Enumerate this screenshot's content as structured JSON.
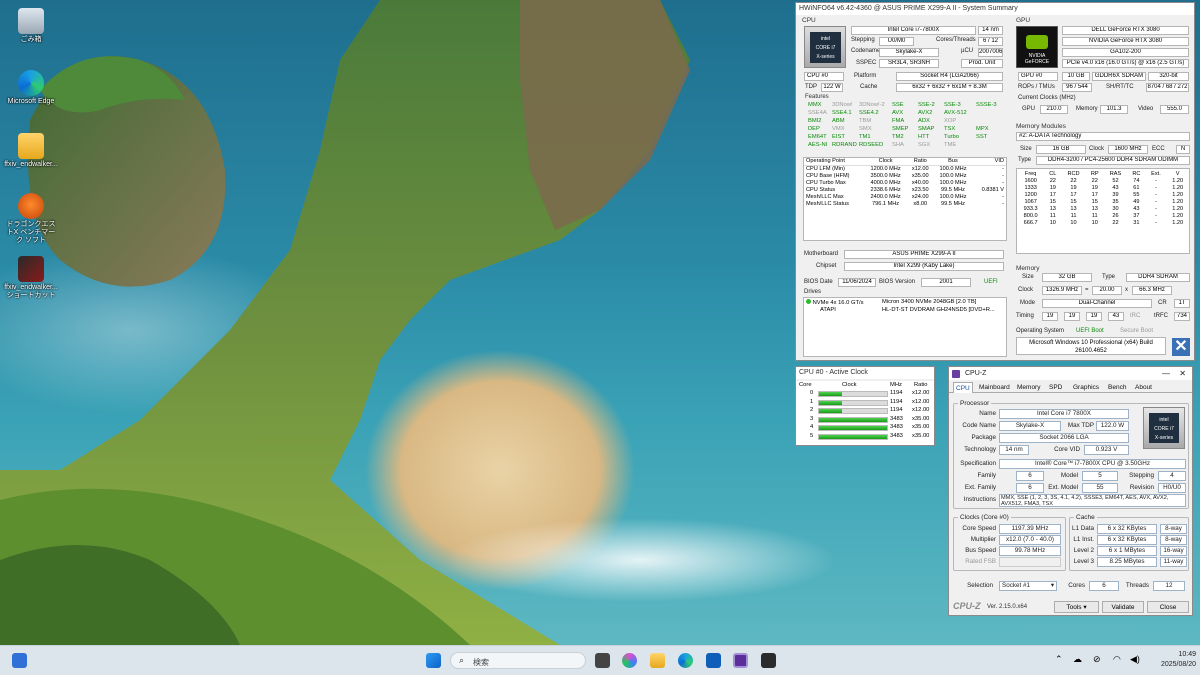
{
  "desktop": {
    "icons": [
      {
        "label": "ごみ箱",
        "icon": "recycle-bin-icon"
      },
      {
        "label": "Microsoft Edge",
        "icon": "edge-icon"
      },
      {
        "label": "ffxiv_endwalker...",
        "icon": "folder-icon"
      },
      {
        "label": "ドラゴンクエストX ベンチマーク ソフト",
        "icon": "dqx-benchmark-icon"
      },
      {
        "label": "ffxiv_endwalker... ショートカット",
        "icon": "ffxiv-shortcut-icon"
      }
    ]
  },
  "hwinfo": {
    "title": "HWiNFO64 v6.42-4360 @ ASUS PRIME X299-A II - System Summary",
    "cpu": {
      "section": "CPU",
      "name": "Intel Core i7-7800X",
      "node": "14 nm",
      "stepping_label": "Stepping",
      "stepping": "U0/M0",
      "ct_label": "Cores/Threads",
      "ct": "6 / 12",
      "codename_label": "Codename",
      "codename": "Skylake-X",
      "ucu_label": "µCU",
      "ucu": "2007006",
      "sspec_label": "SSPEC",
      "sspec": "SR3L4, SR3NH",
      "prod": "Prod. Unit",
      "sel": "CPU #0",
      "platform_label": "Platform",
      "platform": "Socket R4 (LGA2066)",
      "tdp_label": "TDP",
      "tdp": "122 W",
      "cache_label": "Cache",
      "cache": "6x32 + 6x32 + 6x1M + 8.3M",
      "features_label": "Features",
      "features": [
        [
          [
            "MMX",
            "g"
          ],
          [
            "3DNow!",
            "y"
          ],
          [
            "3DNow!-2",
            "y"
          ],
          [
            "SSE",
            "g"
          ],
          [
            "SSE-2",
            "g"
          ],
          [
            "SSE-3",
            "g"
          ],
          [
            "SSSE-3",
            "g"
          ]
        ],
        [
          [
            "SSE4A",
            "y"
          ],
          [
            "SSE4.1",
            "g"
          ],
          [
            "SSE4.2",
            "g"
          ],
          [
            "AVX",
            "g"
          ],
          [
            "AVX2",
            "g"
          ],
          [
            "AVX-512",
            "g"
          ],
          [
            "",
            ""
          ]
        ],
        [
          [
            "BMI2",
            "g"
          ],
          [
            "ABM",
            "g"
          ],
          [
            "TBM",
            "y"
          ],
          [
            "FMA",
            "g"
          ],
          [
            "ADX",
            "g"
          ],
          [
            "XOP",
            "y"
          ],
          [
            "",
            ""
          ]
        ],
        [
          [
            "DEP",
            "g"
          ],
          [
            "VMX",
            "y"
          ],
          [
            "SMX",
            "y"
          ],
          [
            "SMEP",
            "g"
          ],
          [
            "SMAP",
            "g"
          ],
          [
            "TSX",
            "g"
          ],
          [
            "MPX",
            "g"
          ]
        ],
        [
          [
            "EM64T",
            "g"
          ],
          [
            "EIST",
            "g"
          ],
          [
            "TM1",
            "g"
          ],
          [
            "TM2",
            "g"
          ],
          [
            "HTT",
            "g"
          ],
          [
            "Turbo",
            "g"
          ],
          [
            "SST",
            "g"
          ]
        ],
        [
          [
            "AES-NI",
            "g"
          ],
          [
            "RDRAND",
            "g"
          ],
          [
            "RDSEED",
            "g"
          ],
          [
            "SHA",
            "y"
          ],
          [
            "SGX",
            "y"
          ],
          [
            "TME",
            "y"
          ],
          [
            "",
            ""
          ]
        ]
      ],
      "op_headers": [
        "Operating Point",
        "Clock",
        "Ratio",
        "Bus",
        "VID"
      ],
      "op_rows": [
        [
          "CPU LFM (Min)",
          "1200.0 MHz",
          "x12.00",
          "100.0 MHz",
          "-"
        ],
        [
          "CPU Base (HFM)",
          "3500.0 MHz",
          "x35.00",
          "100.0 MHz",
          "-"
        ],
        [
          "CPU Turbo Max",
          "4000.0 MHz",
          "x40.00",
          "100.0 MHz",
          "-"
        ],
        [
          "CPU Status",
          "2338.6 MHz",
          "x23.50",
          "99.5 MHz",
          "0.8381 V"
        ],
        [
          "Mesh/LLC Max",
          "2400.0 MHz",
          "x24.00",
          "100.0 MHz",
          "-"
        ],
        [
          "Mesh/LLC Status",
          "796.1 MHz",
          "x8.00",
          "99.5 MHz",
          "-"
        ]
      ],
      "mb_label": "Motherboard",
      "mb": "ASUS PRIME X299-A II",
      "chipset_label": "Chipset",
      "chipset": "Intel X299 (Kaby Lake)",
      "bios_date_label": "BIOS Date",
      "bios_date": "11/06/2024",
      "bios_ver_label": "BIOS Version",
      "bios_ver": "2001",
      "uefi": "UEFI",
      "drives_label": "Drives",
      "drives": [
        [
          "NVMe 4x 16.0 GT/s",
          "Micron 3400 NVMe 2048GB [2.0 TB]"
        ],
        [
          "ATAPI",
          "HL-DT-ST DVDRAM GH24NSD5 [DVD+R..."
        ]
      ]
    },
    "gpu": {
      "section": "GPU",
      "name": "DELL GeForce RTX 3080",
      "full": "NVIDIA GeForce RTX 3080",
      "chip": "GA102-200",
      "pcie": "PCIe v4.0 x16 (16.0 GT/s) @ x16 (2.5 GT/s)",
      "sel": "GPU #0",
      "mem": "10 GB",
      "memtype": "GDDR6X SDRAM",
      "bus": "320-bit",
      "rops_label": "ROPs / TMUs",
      "rops": "96 / 544",
      "sh_label": "SH/RT/TC",
      "sh": "8704 / 68 / 272",
      "clocks_label": "Current Clocks (MHz)",
      "gpu_label": "GPU",
      "gpu_clk": "210.0",
      "mem_label": "Memory",
      "mem_clk": "101.3",
      "video_label": "Video",
      "video_clk": "555.0"
    },
    "modules": {
      "section": "Memory Modules",
      "sel": "#2: A-DATA Technology",
      "size_label": "Size",
      "size": "16 GB",
      "clock_label": "Clock",
      "clock": "1600 MHz",
      "ecc_label": "ECC",
      "ecc": "N",
      "type_label": "Type",
      "type": "DDR4-3200 / PC4-25600 DDR4 SDRAM UDIMM",
      "headers": [
        "Freq",
        "CL",
        "RCD",
        "RP",
        "RAS",
        "RC",
        "Ext.",
        "V"
      ],
      "rows": [
        [
          "1600",
          "22",
          "22",
          "22",
          "52",
          "74",
          "-",
          "1.20"
        ],
        [
          "1333",
          "19",
          "19",
          "19",
          "43",
          "61",
          "-",
          "1.20"
        ],
        [
          "1200",
          "17",
          "17",
          "17",
          "39",
          "55",
          "-",
          "1.20"
        ],
        [
          "1067",
          "15",
          "15",
          "15",
          "35",
          "49",
          "-",
          "1.20"
        ],
        [
          "933.3",
          "13",
          "13",
          "13",
          "30",
          "43",
          "-",
          "1.20"
        ],
        [
          "800.0",
          "11",
          "11",
          "11",
          "26",
          "37",
          "-",
          "1.20"
        ],
        [
          "666.7",
          "10",
          "10",
          "10",
          "22",
          "31",
          "-",
          "1.20"
        ]
      ]
    },
    "memory": {
      "section": "Memory",
      "size_label": "Size",
      "size": "32 GB",
      "type_label": "Type",
      "type": "DDR4 SDRAM",
      "clock_label": "Clock",
      "clock": "1326.9 MHz",
      "eq": "=",
      "mult": "20.00",
      "x": "x",
      "base": "66.3 MHz",
      "mode_label": "Mode",
      "mode": "Dual-Channel",
      "cr_label": "CR",
      "cr": "1T",
      "timing_label": "Timing",
      "t1": "19",
      "t2": "19",
      "t3": "19",
      "t4": "43",
      "trc": "tRC",
      "trfc_label": "tRFC",
      "trfc": "734"
    },
    "os": {
      "section": "Operating System",
      "uefi": "UEFI Boot",
      "secure": "Secure Boot",
      "name": "Microsoft Windows 10 Professional (x64) Build 26100.4652"
    }
  },
  "active_clock": {
    "title": "CPU #0 - Active Clock",
    "headers": [
      "Core",
      "Clock",
      "MHz",
      "Ratio"
    ],
    "rows": [
      {
        "core": "0",
        "fill": 0.34,
        "mhz": "1194",
        "ratio": "x12.00"
      },
      {
        "core": "1",
        "fill": 0.34,
        "mhz": "1194",
        "ratio": "x12.00"
      },
      {
        "core": "2",
        "fill": 0.34,
        "mhz": "1194",
        "ratio": "x12.00"
      },
      {
        "core": "3",
        "fill": 1.0,
        "mhz": "3483",
        "ratio": "x35.00"
      },
      {
        "core": "4",
        "fill": 1.0,
        "mhz": "3483",
        "ratio": "x35.00"
      },
      {
        "core": "5",
        "fill": 1.0,
        "mhz": "3483",
        "ratio": "x35.00"
      }
    ]
  },
  "cpuz": {
    "title": "CPU-Z",
    "tabs": [
      "CPU",
      "Mainboard",
      "Memory",
      "SPD",
      "Graphics",
      "Bench",
      "About"
    ],
    "processor_label": "Processor",
    "name_label": "Name",
    "name": "Intel Core i7 7800X",
    "codename_label": "Code Name",
    "codename": "Skylake-X",
    "tdp_label": "Max TDP",
    "tdp": "122.0 W",
    "package_label": "Package",
    "package": "Socket 2066 LGA",
    "tech_label": "Technology",
    "tech": "14 nm",
    "vid_label": "Core VID",
    "vid": "0.923 V",
    "spec_label": "Specification",
    "spec": "Intel® Core™ i7-7800X CPU @ 3.50GHz",
    "family_label": "Family",
    "family": "6",
    "model_label": "Model",
    "model": "5",
    "stepping_label": "Stepping",
    "stepping": "4",
    "extfam_label": "Ext. Family",
    "extfam": "6",
    "extmod_label": "Ext. Model",
    "extmod": "55",
    "rev_label": "Revision",
    "rev": "H0/U0",
    "instr_label": "Instructions",
    "instr": "MMX, SSE (1, 2, 3, 3S, 4.1, 4.2), SSSE3, EM64T, AES, AVX, AVX2, AVX512, FMA3, TSX",
    "clocks_label": "Clocks (Core #0)",
    "speed_label": "Core Speed",
    "speed": "1197.39 MHz",
    "mult_label": "Multiplier",
    "mult": "x12.0 (7.0 - 40.0)",
    "bus_label": "Bus Speed",
    "bus": "99.78 MHz",
    "fsb_label": "Rated FSB",
    "fsb": "",
    "cache_label": "Cache",
    "l1d_label": "L1 Data",
    "l1d": "6 x 32 KBytes",
    "l1d_way": "8-way",
    "l1i_label": "L1 Inst.",
    "l1i": "6 x 32 KBytes",
    "l1i_way": "8-way",
    "l2_label": "Level 2",
    "l2": "6 x 1 MBytes",
    "l2_way": "16-way",
    "l3_label": "Level 3",
    "l3": "8.25 MBytes",
    "l3_way": "11-way",
    "sel_label": "Selection",
    "sel": "Socket #1",
    "cores_label": "Cores",
    "cores": "6",
    "threads_label": "Threads",
    "threads": "12",
    "brand": "CPU-Z",
    "version": "Ver. 2.15.0.x64",
    "tools": "Tools",
    "validate": "Validate",
    "close": "Close"
  },
  "taskbar": {
    "search": "検索",
    "time": "10:49",
    "date": "2025/08/20"
  }
}
